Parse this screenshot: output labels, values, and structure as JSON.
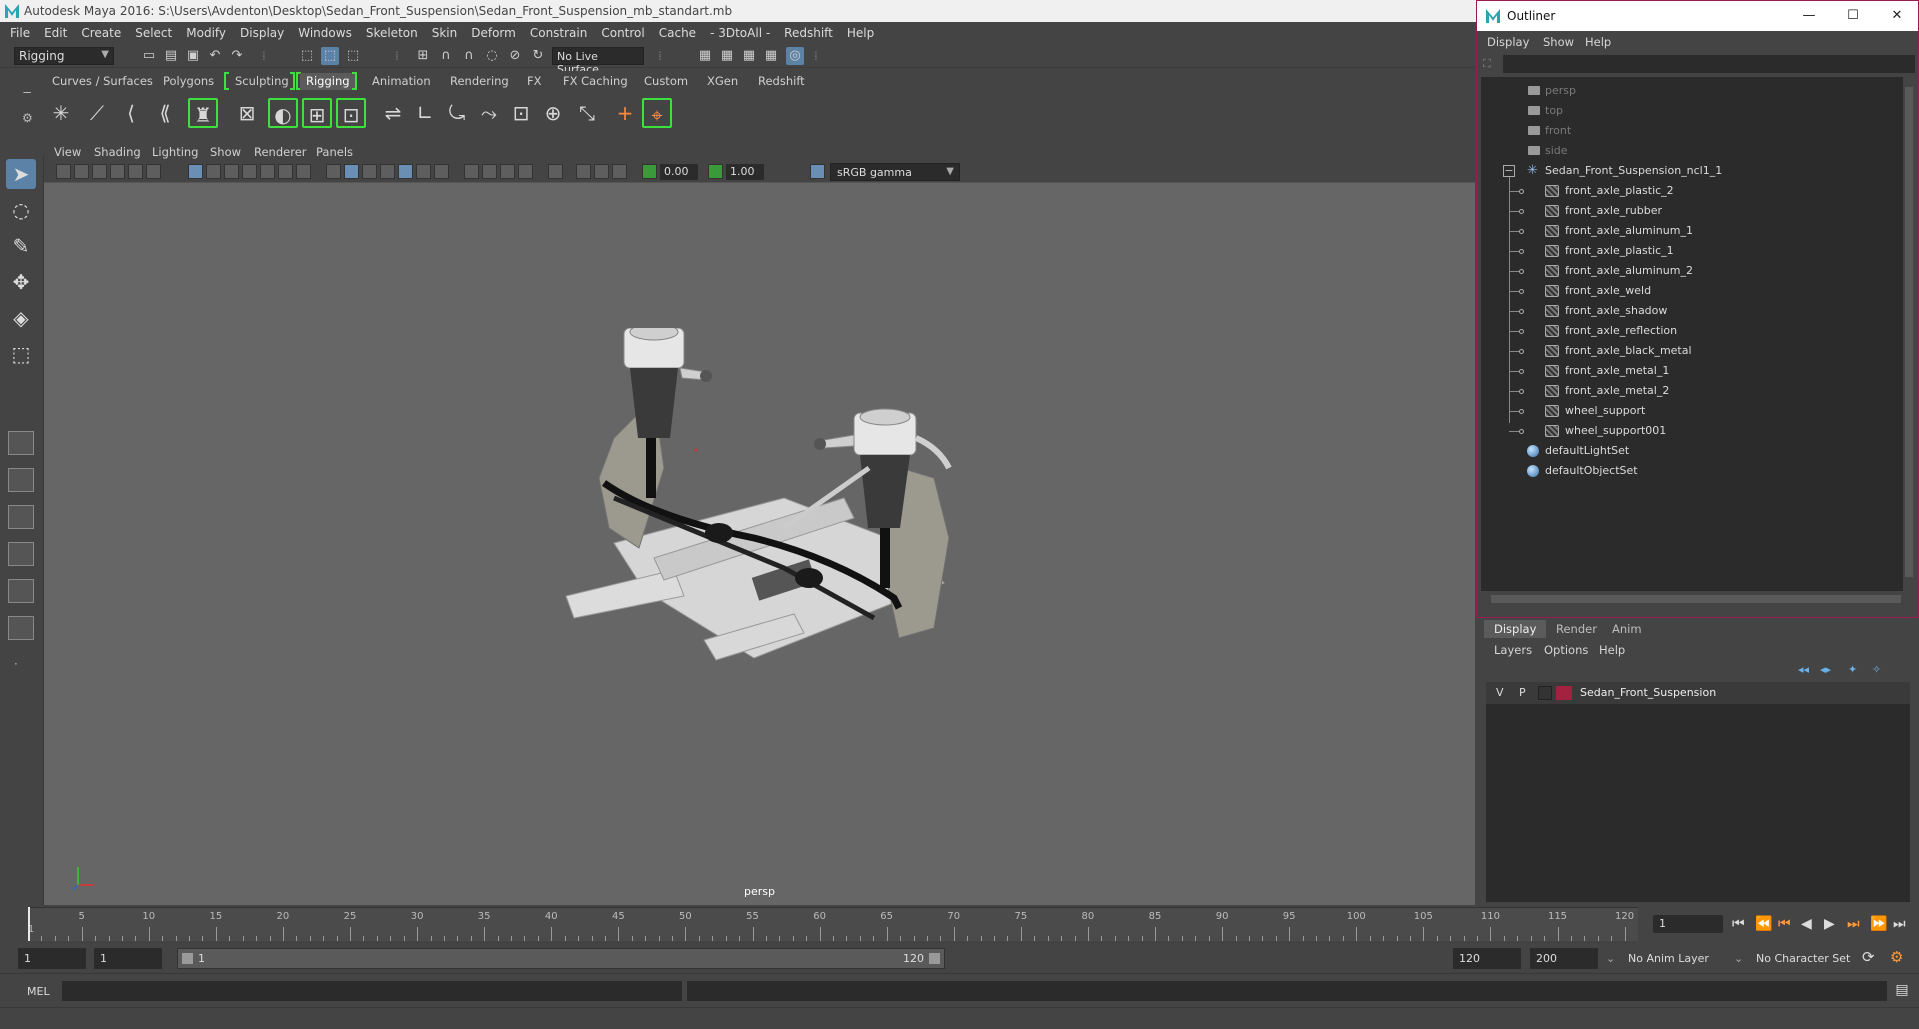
{
  "app": {
    "title": "Autodesk Maya 2016: S:\\Users\\Avdenton\\Desktop\\Sedan_Front_Suspension\\Sedan_Front_Suspension_mb_standart.mb"
  },
  "menubar": [
    "File",
    "Edit",
    "Create",
    "Select",
    "Modify",
    "Display",
    "Windows",
    "Skeleton",
    "Skin",
    "Deform",
    "Constrain",
    "Control",
    "Cache",
    "- 3DtoAll -",
    "Redshift",
    "Help"
  ],
  "statusline": {
    "mode": "Rigging",
    "live_surface": "No Live Surface"
  },
  "shelf": {
    "tabs": [
      "Curves / Surfaces",
      "Polygons",
      "Sculpting",
      "Rigging",
      "Animation",
      "Rendering",
      "FX",
      "FX Caching",
      "Custom",
      "XGen",
      "Redshift"
    ],
    "active_tab": "Rigging"
  },
  "viewport": {
    "menu": [
      "View",
      "Shading",
      "Lighting",
      "Show",
      "Renderer",
      "Panels"
    ],
    "exposure": "0.00",
    "gamma_value": "1.00",
    "color_space": "sRGB gamma",
    "camera_label": "persp"
  },
  "timeline": {
    "ticks": [
      "5",
      "10",
      "15",
      "20",
      "25",
      "30",
      "35",
      "40",
      "45",
      "50",
      "55",
      "60",
      "65",
      "70",
      "75",
      "80",
      "85",
      "90",
      "95",
      "100",
      "105",
      "110",
      "115",
      "120"
    ],
    "start_label": "1",
    "current_frame": "1"
  },
  "range": {
    "start": "1",
    "playback_start": "1",
    "slider_start": "1",
    "slider_end": "120",
    "playback_end": "120",
    "end": "200",
    "anim_layer": "No Anim Layer",
    "character_set": "No Character Set"
  },
  "cmdline": {
    "label": "MEL"
  },
  "outliner": {
    "title": "Outliner",
    "menu": [
      "Display",
      "Show",
      "Help"
    ],
    "cameras": [
      "persp",
      "top",
      "front",
      "side"
    ],
    "group": "Sedan_Front_Suspension_ncl1_1",
    "children": [
      "front_axle_plastic_2",
      "front_axle_rubber",
      "front_axle_aluminum_1",
      "front_axle_plastic_1",
      "front_axle_aluminum_2",
      "front_axle_weld",
      "front_axle_shadow",
      "front_axle_reflection",
      "front_axle_black_metal",
      "front_axle_metal_1",
      "front_axle_metal_2",
      "wheel_support",
      "wheel_support001"
    ],
    "sets": [
      "defaultLightSet",
      "defaultObjectSet"
    ]
  },
  "layer_editor": {
    "tabs": [
      "Display",
      "Render",
      "Anim"
    ],
    "active_tab": "Display",
    "menu": [
      "Layers",
      "Options",
      "Help"
    ],
    "layer": {
      "visible": "V",
      "playback": "P",
      "name": "Sedan_Front_Suspension",
      "color": "#a3223f"
    }
  }
}
